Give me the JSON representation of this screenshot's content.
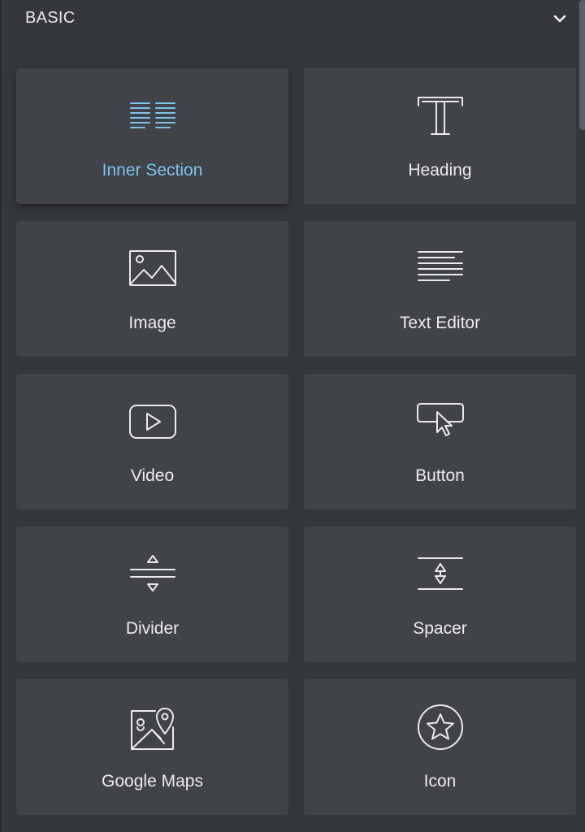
{
  "panel": {
    "section_title": "BASIC",
    "collapse_icon": "chevron-down-icon"
  },
  "colors": {
    "background": "#34373c",
    "tile": "#404348",
    "text": "#eaecee",
    "active_accent": "#7dc4ea"
  },
  "widgets": [
    {
      "label": "Inner Section",
      "icon": "inner-section-icon",
      "active": true
    },
    {
      "label": "Heading",
      "icon": "heading-icon",
      "active": false
    },
    {
      "label": "Image",
      "icon": "image-icon",
      "active": false
    },
    {
      "label": "Text Editor",
      "icon": "text-editor-icon",
      "active": false
    },
    {
      "label": "Video",
      "icon": "video-icon",
      "active": false
    },
    {
      "label": "Button",
      "icon": "button-icon",
      "active": false
    },
    {
      "label": "Divider",
      "icon": "divider-icon",
      "active": false
    },
    {
      "label": "Spacer",
      "icon": "spacer-icon",
      "active": false
    },
    {
      "label": "Google Maps",
      "icon": "google-maps-icon",
      "active": false
    },
    {
      "label": "Icon",
      "icon": "star-icon",
      "active": false
    }
  ]
}
